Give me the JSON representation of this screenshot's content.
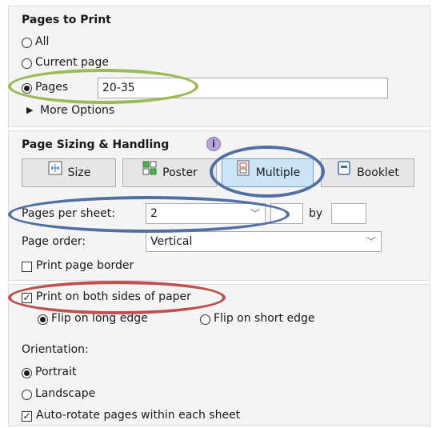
{
  "pages_to_print": {
    "heading": "Pages to Print",
    "all_label": "All",
    "current_page_label": "Current page",
    "pages_label": "Pages",
    "pages_value": "20-35",
    "more_options_label": "More Options"
  },
  "page_sizing": {
    "heading": "Page Sizing & Handling",
    "info_icon": "i",
    "buttons": [
      "Size",
      "Poster",
      "Multiple",
      "Booklet"
    ],
    "active_button": "Multiple",
    "pages_per_sheet_label": "Pages per sheet:",
    "pages_per_sheet_value": "2",
    "by_label": "by",
    "page_order_label": "Page order:",
    "page_order_value": "Vertical",
    "print_page_border_label": "Print page border"
  },
  "duplex": {
    "print_both_sides_label": "Print on both sides of paper",
    "flip_long_label": "Flip on long edge",
    "flip_short_label": "Flip on short edge",
    "orientation_label": "Orientation:",
    "portrait_label": "Portrait",
    "landscape_label": "Landscape",
    "auto_rotate_label": "Auto-rotate pages within each sheet"
  },
  "annotation_colors": {
    "green": "#9bbb59",
    "blue": "#4f6fa5",
    "red": "#c0504d"
  }
}
